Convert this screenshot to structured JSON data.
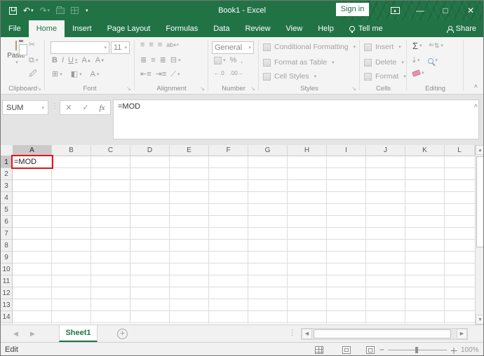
{
  "window": {
    "title": "Book1 - Excel",
    "sign_in": "Sign in"
  },
  "qat": {
    "icons": [
      "save-icon",
      "undo-icon",
      "redo-icon",
      "open-icon",
      "table-icon",
      "customize-quick-access-icon"
    ]
  },
  "tabs": {
    "items": [
      "File",
      "Home",
      "Insert",
      "Page Layout",
      "Formulas",
      "Data",
      "Review",
      "View",
      "Help"
    ],
    "active": "Home",
    "tell_me": "Tell me",
    "share": "Share"
  },
  "ribbon": {
    "clipboard": {
      "label": "Clipboard",
      "paste": "Paste"
    },
    "font": {
      "label": "Font",
      "size": "11",
      "bold": "B",
      "italic": "I",
      "underline": "U",
      "grow": "A",
      "shrink": "A"
    },
    "alignment": {
      "label": "Alignment"
    },
    "number": {
      "label": "Number",
      "format": "General",
      "percent": "%",
      "comma": ","
    },
    "styles": {
      "label": "Styles",
      "items": [
        "Conditional Formatting",
        "Format as Table",
        "Cell Styles"
      ]
    },
    "cells": {
      "label": "Cells",
      "items": [
        "Insert",
        "Delete",
        "Format"
      ]
    },
    "editing": {
      "label": "Editing",
      "autosum": "Σ"
    }
  },
  "formula_bar": {
    "name_box": "SUM",
    "cancel": "✕",
    "enter": "✓",
    "insert_function": "fx",
    "formula": "=MOD"
  },
  "grid": {
    "columns": [
      "A",
      "B",
      "C",
      "D",
      "E",
      "F",
      "G",
      "H",
      "I",
      "J",
      "K",
      "L"
    ],
    "rows": [
      "1",
      "2",
      "3",
      "4",
      "5",
      "6",
      "7",
      "8",
      "9",
      "10",
      "11",
      "12",
      "13",
      "14"
    ],
    "active_column": "A",
    "active_row": "1",
    "cells": {
      "A1": "=MOD"
    }
  },
  "sheet_bar": {
    "tabs": [
      "Sheet1"
    ],
    "active": "Sheet1",
    "add_label": "+"
  },
  "status_bar": {
    "mode": "Edit",
    "zoom": "100%"
  },
  "colors": {
    "excel_green": "#217346",
    "annotation_red": "#e0151a",
    "ribbon_bg": "#f4f4f4",
    "header_selected": "#cacaca"
  }
}
